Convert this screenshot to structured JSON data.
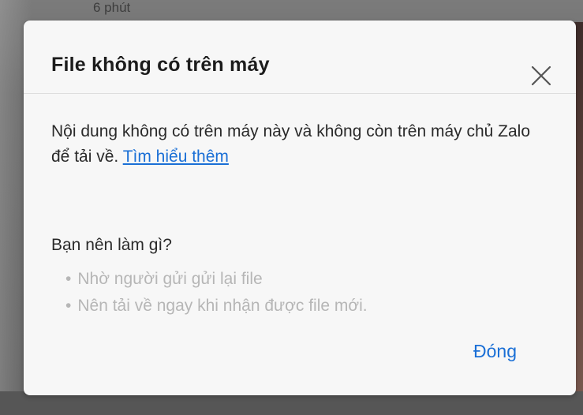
{
  "background": {
    "time_label": "6 phút"
  },
  "dialog": {
    "title": "File không có trên máy",
    "message_prefix": "Nội dung không có trên máy này và không còn trên máy chủ Zalo để tải về. ",
    "learn_more": "Tìm hiểu thêm",
    "section_title": "Bạn nên làm gì?",
    "tips": [
      "Nhờ người gửi gửi lại file",
      "Nên tải về ngay khi nhận được file mới."
    ],
    "bullet": "•",
    "close_label": "Đóng",
    "close_icon": "close-icon"
  },
  "colors": {
    "link": "#1a6fd6",
    "dialog_bg": "#f7f7f7",
    "tip_text": "#b6b6b6"
  }
}
